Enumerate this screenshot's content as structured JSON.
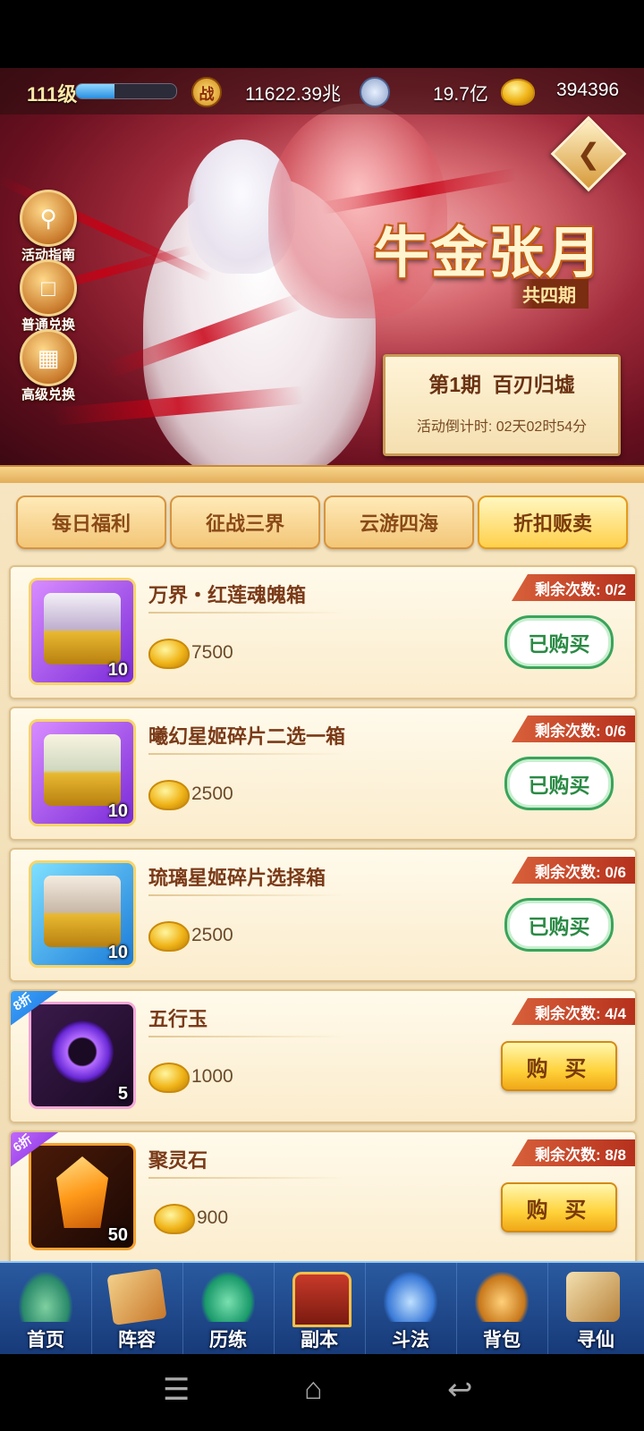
{
  "topbar": {
    "level": "111级",
    "xp_fraction": 0.38,
    "power": "11622.39兆",
    "coins": "19.7亿",
    "gold": "394396",
    "power_icon": "battle-icon",
    "coin_icon": "silver-coin-icon",
    "gold_icon": "gold-ingot-icon"
  },
  "side_buttons": [
    {
      "label": "活动指南",
      "icon": "magnifier-icon"
    },
    {
      "label": "普通兑换",
      "icon": "gift-box-icon"
    },
    {
      "label": "高级兑换",
      "icon": "gift-icon"
    }
  ],
  "event": {
    "title": "牛金张月",
    "subtitle": "共四期",
    "phase": "第1期  百刃归墟",
    "countdown": "活动倒计时: 02天02时54分"
  },
  "tabs": [
    {
      "label": "每日福利",
      "active": false
    },
    {
      "label": "征战三界",
      "active": false
    },
    {
      "label": "云游四海",
      "active": false
    },
    {
      "label": "折扣贩卖",
      "active": true
    }
  ],
  "items": [
    {
      "name": "万界・红莲魂魄箱",
      "price": "7500",
      "qty": "10",
      "remain": "剩余次数: 0/2",
      "button": "已购买",
      "bought": true,
      "discount": ""
    },
    {
      "name": "曦幻星姬碎片二选一箱",
      "price": "2500",
      "qty": "10",
      "remain": "剩余次数: 0/6",
      "button": "已购买",
      "bought": true,
      "discount": ""
    },
    {
      "name": "琉璃星姬碎片选择箱",
      "price": "2500",
      "qty": "10",
      "remain": "剩余次数: 0/6",
      "button": "已购买",
      "bought": true,
      "discount": ""
    },
    {
      "name": "五行玉",
      "price": "1000",
      "qty": "5",
      "remain": "剩余次数: 4/4",
      "button": "购 买",
      "bought": false,
      "discount": "8折"
    },
    {
      "name": "聚灵石",
      "price": "900",
      "qty": "50",
      "remain": "剩余次数: 8/8",
      "button": "购 买",
      "bought": false,
      "discount": "6折"
    }
  ],
  "nav": [
    {
      "label": "首页",
      "icon": "home-mountain-icon"
    },
    {
      "label": "阵容",
      "icon": "cards-icon"
    },
    {
      "label": "历练",
      "icon": "gourd-icon"
    },
    {
      "label": "副本",
      "icon": "gate-icon"
    },
    {
      "label": "斗法",
      "icon": "sword-altar-icon"
    },
    {
      "label": "背包",
      "icon": "bag-icon"
    },
    {
      "label": "寻仙",
      "icon": "scroll-icon"
    }
  ],
  "system_nav": {
    "menu": "☰",
    "home": "⌂",
    "back": "↩"
  },
  "colors": {
    "accent_gold": "#ffd04a",
    "bought_green": "#3aa45a",
    "remain_red": "#b5301c",
    "nav_blue": "#173a78"
  }
}
